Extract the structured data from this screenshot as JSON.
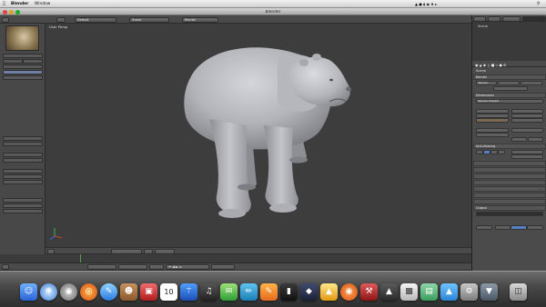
{
  "mac_menubar": {
    "apple": "",
    "app": "Blender",
    "window_menu": "Window",
    "clock": "",
    "user": ""
  },
  "window": {
    "title": "Blender"
  },
  "blender_header": {
    "info_menus": [
      "",
      "",
      ""
    ],
    "screen_layout": "Default",
    "scene": "Scene",
    "engine": "Render",
    "stats": ""
  },
  "tool_shelf": {
    "rows": [
      "",
      "",
      "",
      "",
      "",
      "",
      "",
      "",
      "",
      "",
      "",
      "",
      "",
      "",
      "",
      "",
      "",
      "",
      "",
      "",
      "",
      "",
      "",
      "",
      "",
      "",
      "",
      "",
      ""
    ],
    "mode": ""
  },
  "viewport": {
    "label": "User Persp",
    "object_label": ""
  },
  "viewport_footer": {
    "menus": [
      "",
      "",
      "",
      "",
      ""
    ],
    "mode": "",
    "shading": ""
  },
  "timeline": {
    "numbers": [
      "",
      "",
      "",
      "",
      "",
      "",
      "",
      "",
      "",
      "",
      "",
      "",
      "",
      "",
      "",
      "",
      "",
      "",
      "",
      "",
      "",
      "",
      ""
    ]
  },
  "timeline_footer": {
    "menus": [
      "",
      "",
      "",
      ""
    ],
    "start": "",
    "end": "",
    "frame": "",
    "sync": ""
  },
  "outliner": {
    "tabs": [
      "",
      "",
      ""
    ],
    "search_placeholder": "",
    "items": [
      "Scene",
      "",
      "",
      ""
    ]
  },
  "properties": {
    "context": "Scene",
    "render_panel": "Render",
    "render_buttons": [
      "Render",
      "",
      ""
    ],
    "display": "",
    "display_value": "",
    "dimensions_panel": "Dimensions",
    "render_presets": "Render Presets",
    "resolution_label": "",
    "res_x": "",
    "res_y": "",
    "res_pct": "",
    "frame_range_label": "",
    "frame_start": "",
    "frame_end": "",
    "frame_step": "",
    "aspect_label": "",
    "aspect_x": "",
    "aspect_y": "",
    "frame_rate_label": "",
    "fps": "",
    "time_remap_label": "",
    "border": "",
    "crop": "",
    "remap_old": "",
    "remap_new": "",
    "aa_panel": "Anti-Aliasing",
    "aa_samples": [
      "",
      "",
      "",
      ""
    ],
    "aa_filter": "",
    "full_sample": "",
    "aa_size": "",
    "panels": [
      "",
      "",
      "",
      "",
      "",
      "",
      "",
      "Output"
    ],
    "output_path": "",
    "overwrite": "",
    "file_ext": "",
    "placeholders": "",
    "format": "",
    "color_bw": "",
    "color_rgb": "",
    "color_rgba": ""
  },
  "dock": {
    "calendar_day": "10"
  },
  "colors": {
    "accent_blue": "#5680c2",
    "viewport_bg": "#3d3d3d",
    "header_bg": "#4a4a4a",
    "mesh": "#b8b9be",
    "playhead": "#53a04d"
  }
}
